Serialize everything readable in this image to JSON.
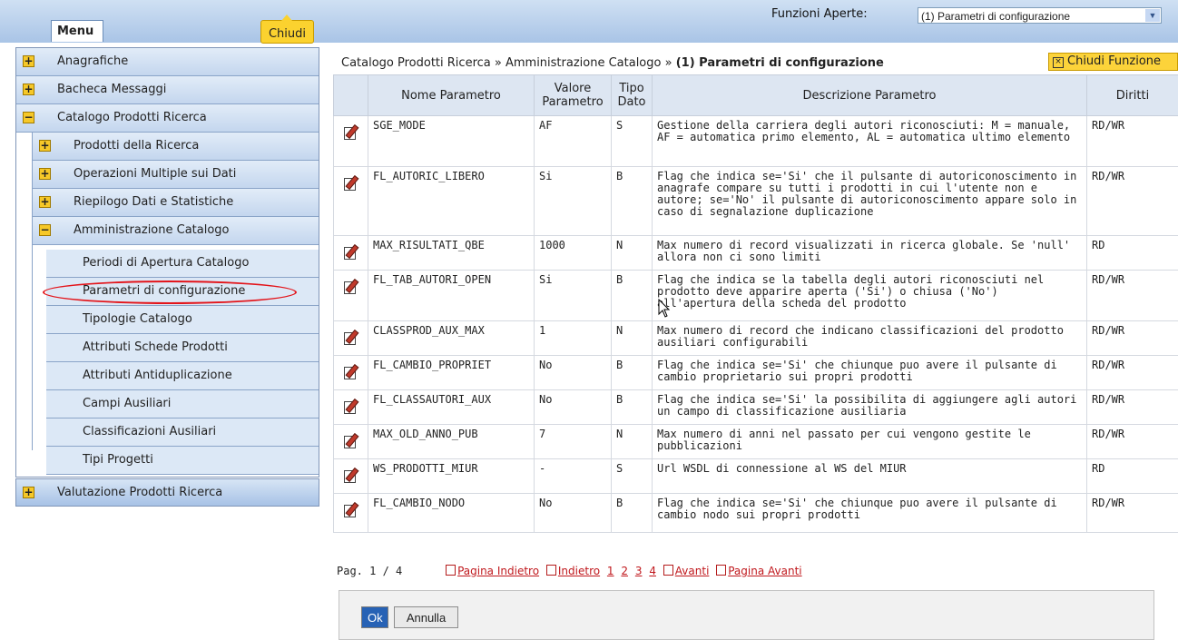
{
  "topbar": {
    "menu_label": "Menu",
    "close_label": "Chiudi",
    "funzioni_label": "Funzioni Aperte:",
    "funzioni_selected": "(1) Parametri di configurazione"
  },
  "sidebar": {
    "items": [
      {
        "label": "Anagrafiche",
        "toggle": "+"
      },
      {
        "label": "Bacheca Messaggi",
        "toggle": "+"
      },
      {
        "label": "Catalogo Prodotti Ricerca",
        "toggle": "−"
      },
      {
        "label": "Prodotti della Ricerca",
        "toggle": "+"
      },
      {
        "label": "Operazioni Multiple sui Dati",
        "toggle": "+"
      },
      {
        "label": "Riepilogo Dati e Statistiche",
        "toggle": "+"
      },
      {
        "label": "Amministrazione Catalogo",
        "toggle": "−"
      },
      {
        "label": "Periodi di Apertura Catalogo"
      },
      {
        "label": "Parametri di configurazione"
      },
      {
        "label": "Tipologie Catalogo"
      },
      {
        "label": "Attributi Schede Prodotti"
      },
      {
        "label": "Attributi Antiduplicazione"
      },
      {
        "label": "Campi Ausiliari"
      },
      {
        "label": "Classificazioni Ausiliari"
      },
      {
        "label": "Tipi Progetti"
      },
      {
        "label": "Valutazione Prodotti Ricerca",
        "toggle": "+"
      }
    ]
  },
  "breadcrumb": {
    "part1": "Catalogo Prodotti Ricerca",
    "sep": " » ",
    "part2": "Amministrazione Catalogo",
    "current": "(1) Parametri di configurazione"
  },
  "close_function_label": "Chiudi Funzione",
  "table": {
    "headers": [
      "",
      "Nome Parametro",
      "Valore Parametro",
      "Tipo Dato",
      "Descrizione Parametro",
      "Diritti"
    ],
    "rows": [
      {
        "name": "SGE_MODE",
        "value": "AF",
        "type": "S",
        "desc": "Gestione della carriera degli autori riconosciuti: M = manuale, AF = automatica primo elemento, AL = automatica ultimo elemento",
        "rights": "RD/WR"
      },
      {
        "name": "FL_AUTORIC_LIBERO",
        "value": "Si",
        "type": "B",
        "desc": "Flag che indica se='Si' che il pulsante di autoriconoscimento in anagrafe compare su tutti i prodotti in cui l'utente non e autore; se='No' il pulsante di autoriconoscimento appare solo in caso di segnalazione duplicazione",
        "rights": "RD/WR"
      },
      {
        "name": "MAX_RISULTATI_QBE",
        "value": "1000",
        "type": "N",
        "desc": "Max numero di record visualizzati in ricerca globale. Se 'null' allora non ci sono limiti",
        "rights": "RD"
      },
      {
        "name": "FL_TAB_AUTORI_OPEN",
        "value": "Si",
        "type": "B",
        "desc": "Flag che indica se la tabella degli autori riconosciuti nel prodotto deve apparire aperta ('Si') o chiusa ('No') all'apertura della scheda del prodotto",
        "rights": "RD/WR"
      },
      {
        "name": "CLASSPROD_AUX_MAX",
        "value": "1",
        "type": "N",
        "desc": "Max numero di record che indicano classificazioni del prodotto ausiliari configurabili",
        "rights": "RD/WR"
      },
      {
        "name": "FL_CAMBIO_PROPRIET",
        "value": "No",
        "type": "B",
        "desc": "Flag che indica se='Si' che chiunque puo avere il pulsante di cambio proprietario sui propri prodotti",
        "rights": "RD/WR"
      },
      {
        "name": "FL_CLASSAUTORI_AUX",
        "value": "No",
        "type": "B",
        "desc": "Flag che indica se='Si' la possibilita di aggiungere agli autori un campo di classificazione ausiliaria",
        "rights": "RD/WR"
      },
      {
        "name": "MAX_OLD_ANNO_PUB",
        "value": "7",
        "type": "N",
        "desc": "Max numero di anni nel passato per cui vengono gestite le pubblicazioni",
        "rights": "RD/WR"
      },
      {
        "name": "WS_PRODOTTI_MIUR",
        "value": "-",
        "type": "S",
        "desc": "Url WSDL di connessione al WS del MIUR",
        "rights": "RD"
      },
      {
        "name": "FL_CAMBIO_NODO",
        "value": "No",
        "type": "B",
        "desc": "Flag che indica se='Si' che chiunque puo avere il pulsante di cambio nodo sui propri prodotti",
        "rights": "RD/WR"
      }
    ]
  },
  "pager": {
    "page_text": "Pag. 1 / 4",
    "first": "Pagina Indietro",
    "prev": "Indietro",
    "pages": [
      "1",
      "2",
      "3",
      "4"
    ],
    "next": "Avanti",
    "last": "Pagina Avanti"
  },
  "buttons": {
    "ok": "Ok",
    "cancel": "Annulla"
  },
  "colors": {
    "accent_yellow": "#fbd22f",
    "highlight_red": "#e3141a",
    "link_red": "#c0181d",
    "ok_blue": "#2762b5"
  }
}
